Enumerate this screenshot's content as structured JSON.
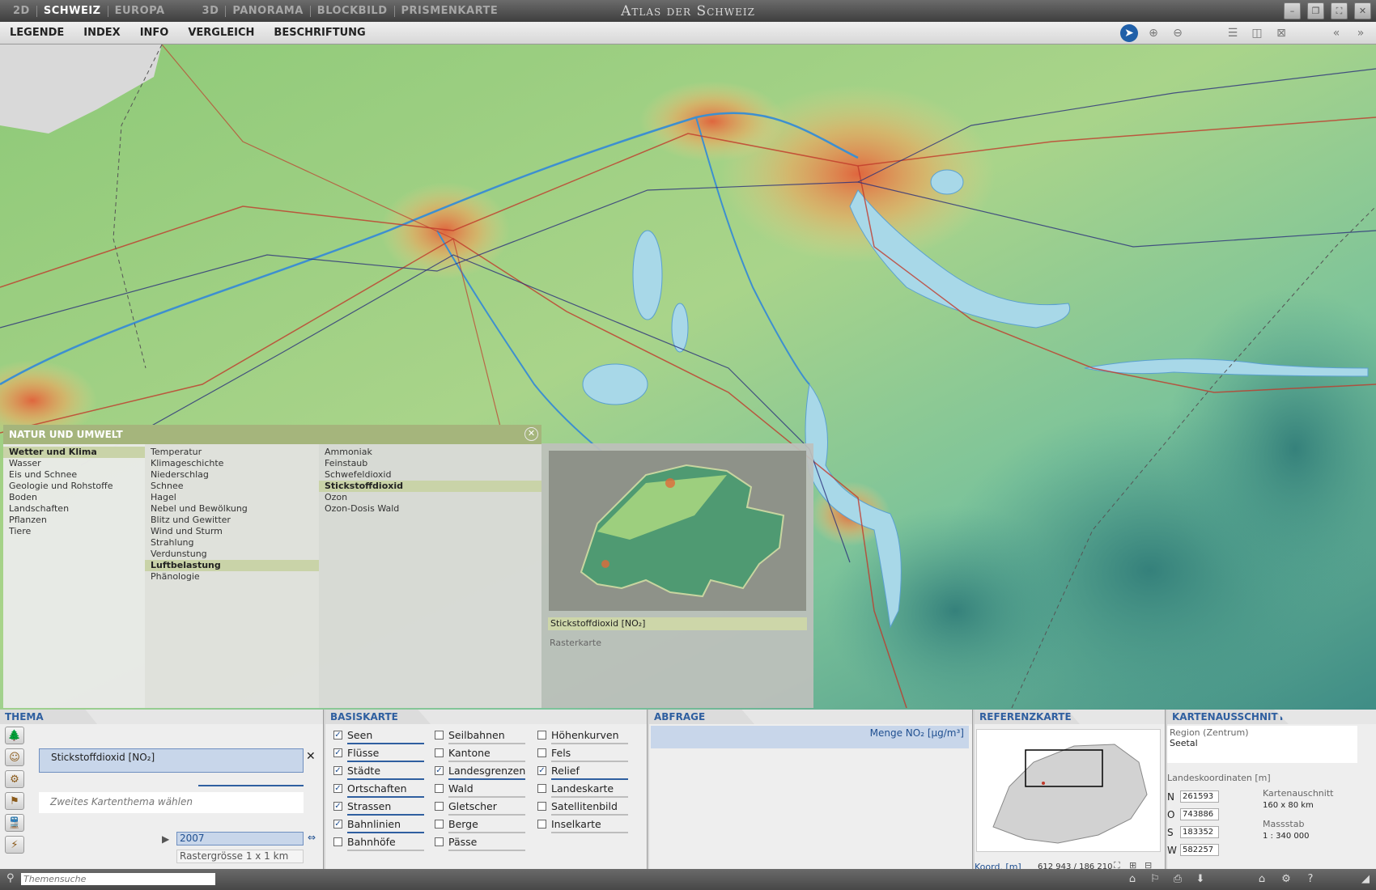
{
  "titlebar": {
    "modes": [
      "2D",
      "SCHWEIZ",
      "EUROPA",
      "3D",
      "PANORAMA",
      "BLOCKBILD",
      "PRISMENKARTE"
    ],
    "title": "Atlas der Schweiz"
  },
  "menu": {
    "items": [
      "LEGENDE",
      "INDEX",
      "INFO",
      "VERGLEICH",
      "BESCHRIFTUNG"
    ]
  },
  "thema_panel": {
    "header": "NATUR UND UMWELT",
    "col1": [
      "Wetter und Klima",
      "Wasser",
      "Eis und Schnee",
      "Geologie und Rohstoffe",
      "Boden",
      "Landschaften",
      "Pflanzen",
      "Tiere"
    ],
    "col2": [
      "Temperatur",
      "Klimageschichte",
      "Niederschlag",
      "Schnee",
      "Hagel",
      "Nebel und Bewölkung",
      "Blitz und Gewitter",
      "Wind und Sturm",
      "Strahlung",
      "Verdunstung",
      "Luftbelastung",
      "Phänologie"
    ],
    "col3": [
      "Ammoniak",
      "Feinstaub",
      "Schwefeldioxid",
      "Stickstoffdioxid",
      "Ozon",
      "Ozon-Dosis Wald"
    ],
    "preview_title": "Stickstoffdioxid [NO₂]",
    "preview_sub": "Rasterkarte"
  },
  "thema": {
    "tab": "THEMA",
    "primary_theme": "Stickstoffdioxid [NO₂]",
    "second_theme_placeholder": "Zweites Kartenthema wählen",
    "year": "2007",
    "raster": "Rastergrösse 1 x 1 km"
  },
  "basiskarte": {
    "tab": "BASISKARTE",
    "layers": [
      {
        "label": "Seen",
        "checked": true
      },
      {
        "label": "Flüsse",
        "checked": true
      },
      {
        "label": "Städte",
        "checked": true
      },
      {
        "label": "Ortschaften",
        "checked": true
      },
      {
        "label": "Strassen",
        "checked": true
      },
      {
        "label": "Bahnlinien",
        "checked": true
      },
      {
        "label": "Bahnhöfe",
        "checked": false
      },
      {
        "label": "Seilbahnen",
        "checked": false
      },
      {
        "label": "Kantone",
        "checked": false
      },
      {
        "label": "Landesgrenzen",
        "checked": true
      },
      {
        "label": "Wald",
        "checked": false
      },
      {
        "label": "Gletscher",
        "checked": false
      },
      {
        "label": "Berge",
        "checked": false
      },
      {
        "label": "Pässe",
        "checked": false
      },
      {
        "label": "Höhenkurven",
        "checked": false
      },
      {
        "label": "Fels",
        "checked": false
      },
      {
        "label": "Relief",
        "checked": true
      },
      {
        "label": "Landeskarte",
        "checked": false
      },
      {
        "label": "Satellitenbild",
        "checked": false
      },
      {
        "label": "Inselkarte",
        "checked": false
      }
    ]
  },
  "abfrage": {
    "tab": "ABFRAGE",
    "quantity": "Menge NO₂ [μg/m³]"
  },
  "referenzkarte": {
    "tab": "REFERENZKARTE",
    "coord_label": "Koord. [m]",
    "coord_value": "612 943 / 186 210"
  },
  "kartenausschnitt": {
    "tab": "KARTENAUSSCHNITT",
    "region_label": "Region (Zentrum)",
    "region": "Seetal",
    "coord_title": "Landeskoordinaten [m]",
    "N": "261593",
    "O": "743886",
    "S": "183352",
    "W": "582257",
    "extent_label": "Kartenauschnitt",
    "extent": "160 x 80 km",
    "scale_label": "Massstab",
    "scale": "1 : 340 000"
  },
  "statusbar": {
    "search_placeholder": "Themensuche"
  }
}
